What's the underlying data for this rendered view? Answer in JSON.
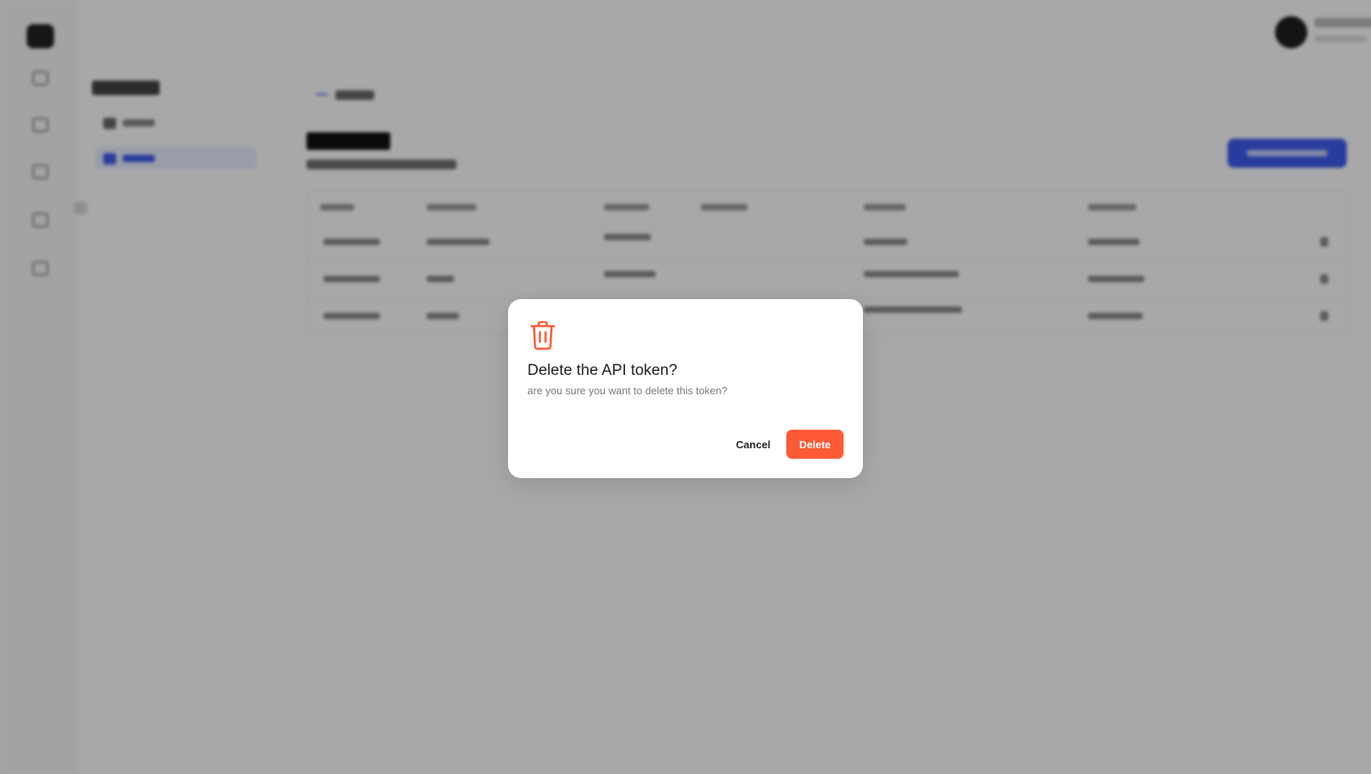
{
  "colors": {
    "accent": "#3e5bf0",
    "danger": "#ff5a36",
    "overlay": "rgba(0,0,0,0.34)"
  },
  "dialog": {
    "icon": "trash-icon",
    "title": "Delete the API token?",
    "message": "are you sure you want to delete this token?",
    "cancel_label": "Cancel",
    "delete_label": "Delete"
  }
}
